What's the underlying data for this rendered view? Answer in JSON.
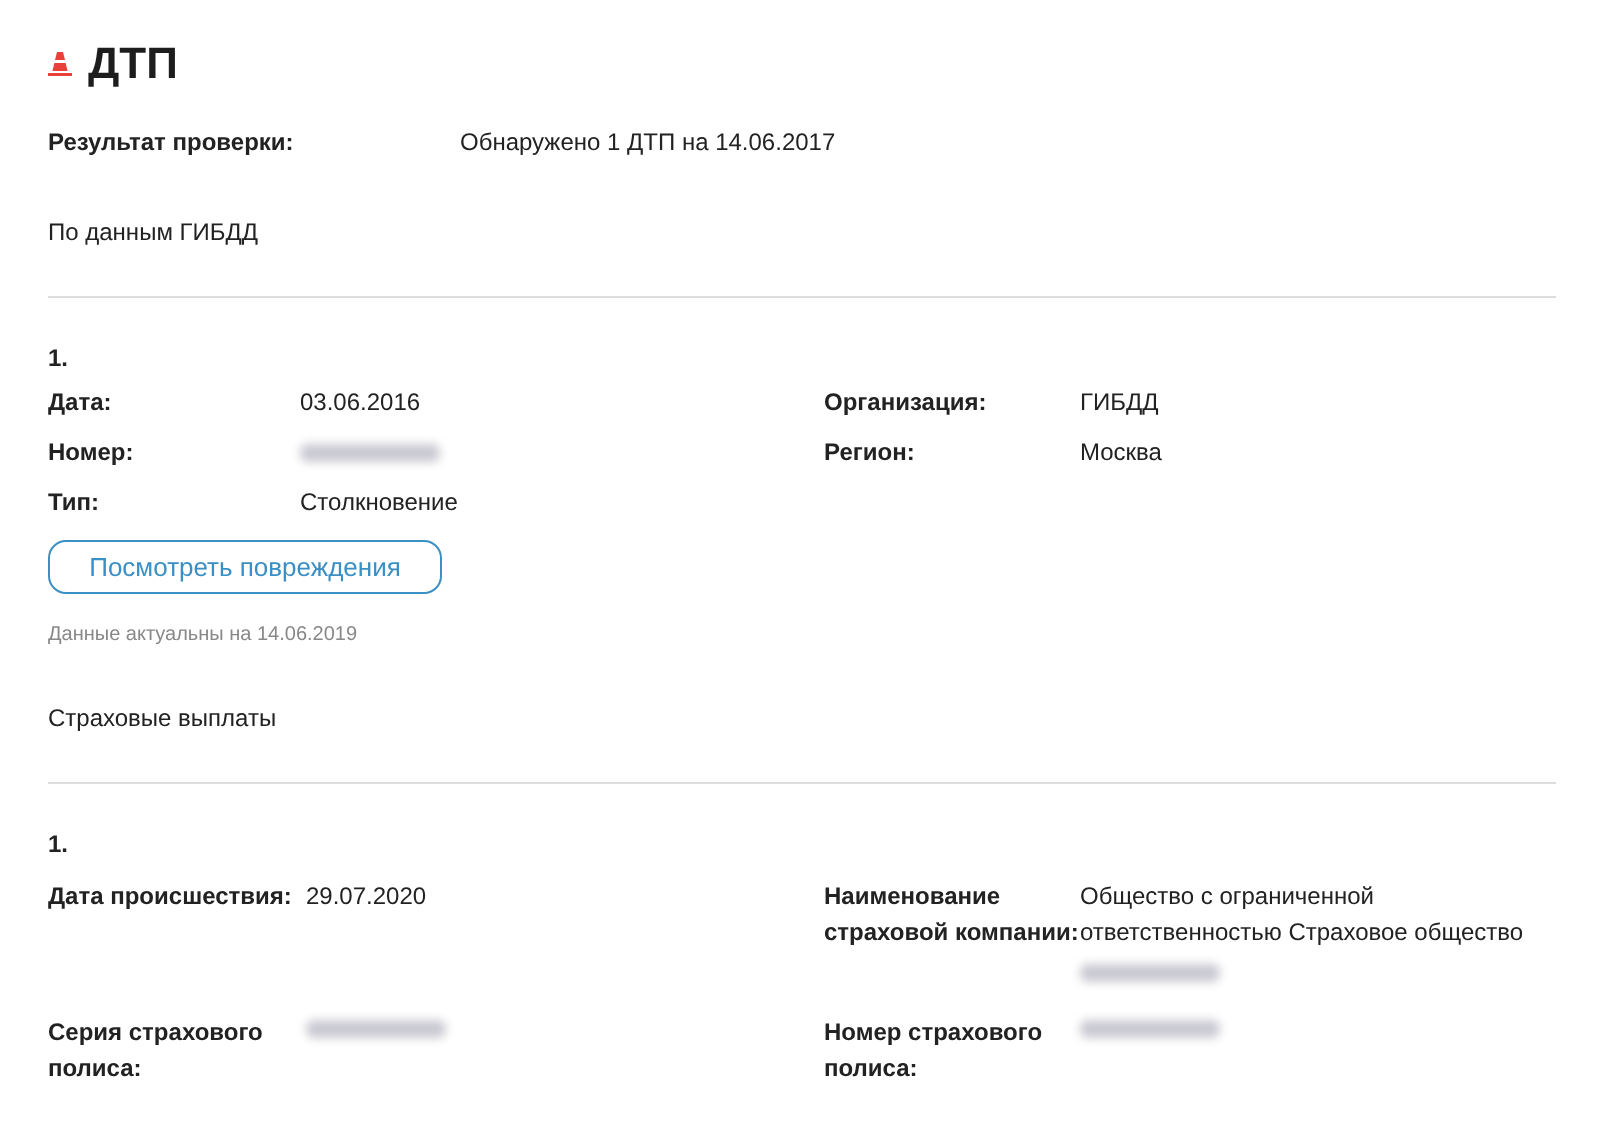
{
  "title": "ДТП",
  "result": {
    "label": "Результат проверки:",
    "value": "Обнаружено 1 ДТП на 14.06.2017"
  },
  "source": "По данным ГИБДД",
  "accidents": [
    {
      "number": "1.",
      "fields": [
        {
          "label": "Дата:",
          "value": "03.06.2016"
        },
        {
          "label": "Организация:",
          "value": "ГИБДД"
        },
        {
          "label": "Номер:",
          "redacted": true
        },
        {
          "label": "Регион:",
          "value": "Москва"
        },
        {
          "label": "Тип:",
          "value": "Столкновение"
        }
      ],
      "button": "Посмотреть повреждения",
      "note": "Данные актуальны на 14.06.2019"
    }
  ],
  "payments_title": "Страховые выплаты",
  "payments": [
    {
      "number": "1.",
      "fields": [
        {
          "label": "Дата происшествия:",
          "value": "29.07.2020"
        },
        {
          "label": "Наименование страховой компании:",
          "value": "Общество с ограниченной ответственностью Страховое общество",
          "redacted": true
        },
        {
          "label": "Серия страхового полиса:",
          "redacted": true
        },
        {
          "label": "Номер страхового полиса:",
          "redacted": true
        }
      ]
    }
  ]
}
